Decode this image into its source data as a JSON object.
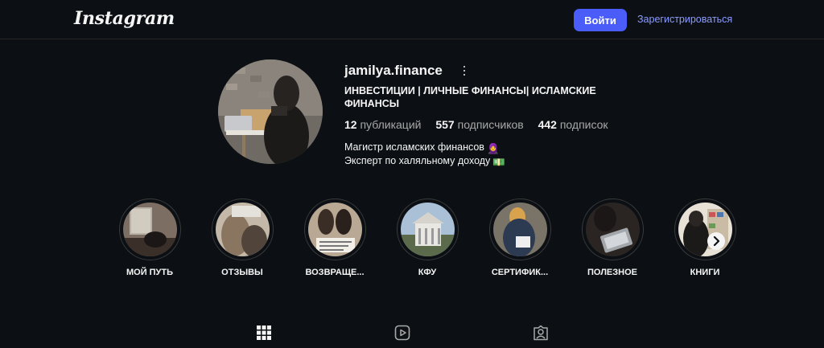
{
  "header": {
    "logo_text": "Instagram",
    "login_label": "Войти",
    "signup_label": "Зарегистрироваться",
    "accent_color": "#4a5df9"
  },
  "profile": {
    "username": "jamilya.finance",
    "full_name": "ИНВЕСТИЦИИ | ЛИЧНЫЕ ФИНАНСЫ| ИСЛАМСКИЕ ФИНАНСЫ",
    "posts_count": "12",
    "posts_label": "публикаций",
    "followers_count": "557",
    "followers_label": "подписчиков",
    "following_count": "442",
    "following_label": "подписок",
    "bio_line1": "Магистр исламских финансов",
    "bio_line1_emoji": "🧕",
    "bio_line2": "Эксперт по халяльному доходу",
    "bio_line2_emoji": "💵"
  },
  "highlights": [
    {
      "label": "МОЙ ПУТЬ"
    },
    {
      "label": "ОТЗЫВЫ"
    },
    {
      "label": "ВОЗВРАЩЕ..."
    },
    {
      "label": "КФУ"
    },
    {
      "label": "СЕРТИФИК..."
    },
    {
      "label": "ПОЛЕЗНОЕ"
    },
    {
      "label": "КНИГИ"
    }
  ],
  "tabs": [
    {
      "icon": "grid-icon"
    },
    {
      "icon": "reels-icon"
    },
    {
      "icon": "tagged-icon"
    }
  ]
}
